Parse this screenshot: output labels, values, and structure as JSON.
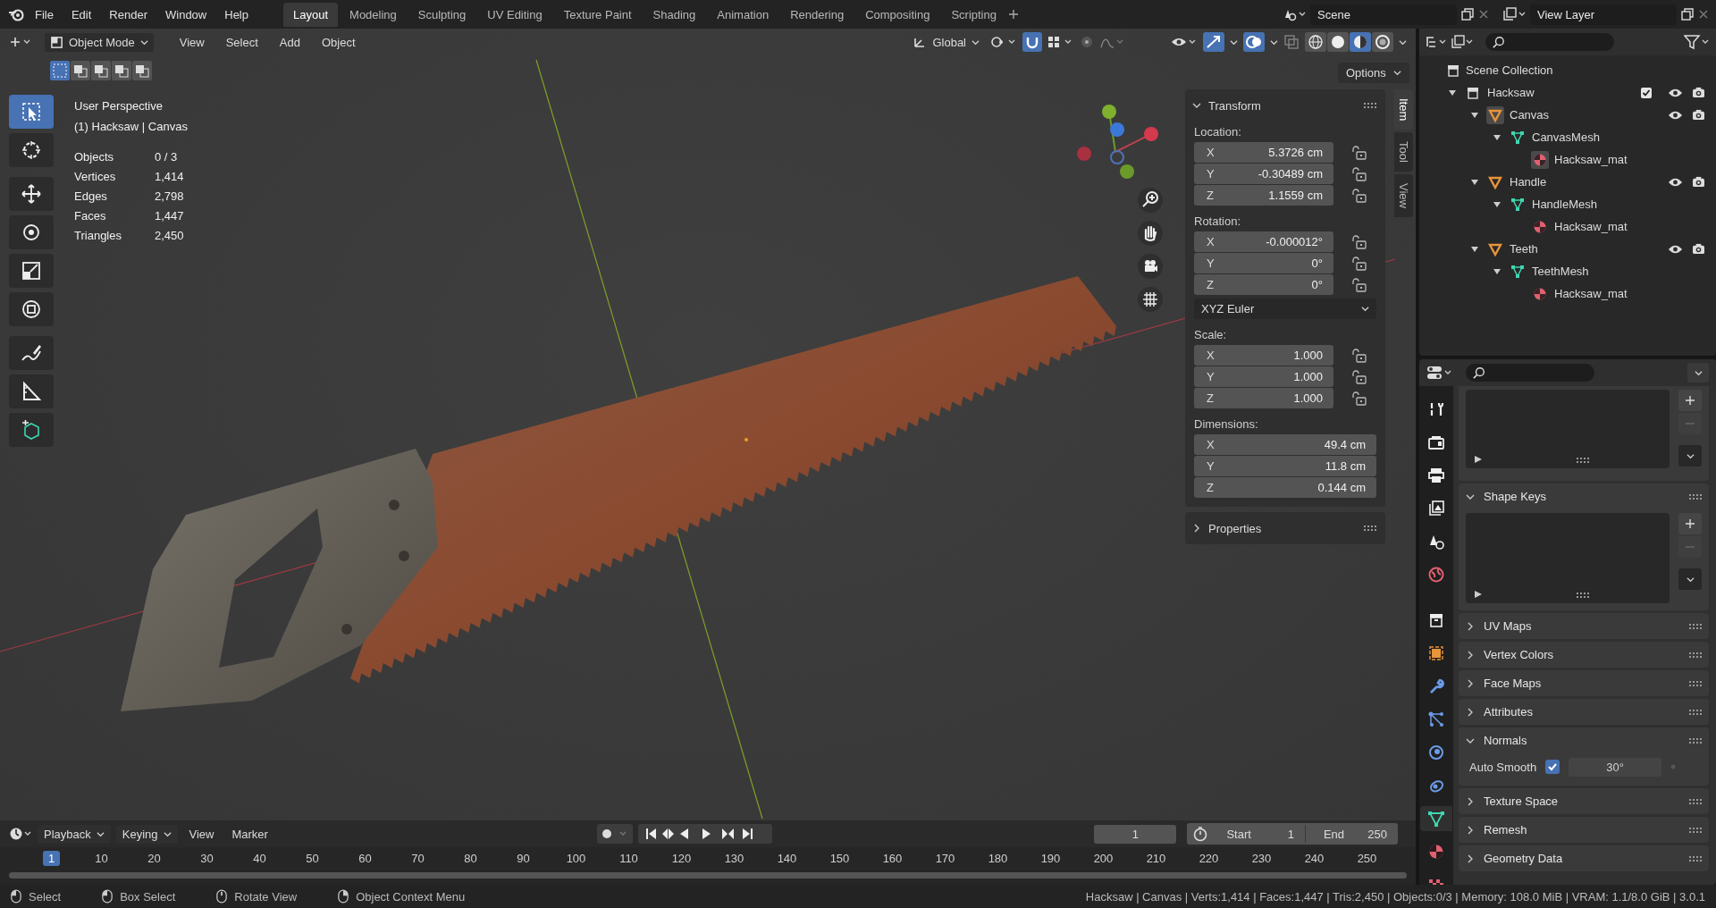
{
  "top_menu": [
    "File",
    "Edit",
    "Render",
    "Window",
    "Help"
  ],
  "workspaces": [
    {
      "label": "Layout",
      "selected": true
    },
    {
      "label": "Modeling",
      "selected": false
    },
    {
      "label": "Sculpting",
      "selected": false
    },
    {
      "label": "UV Editing",
      "selected": false
    },
    {
      "label": "Texture Paint",
      "selected": false
    },
    {
      "label": "Shading",
      "selected": false
    },
    {
      "label": "Animation",
      "selected": false
    },
    {
      "label": "Rendering",
      "selected": false
    },
    {
      "label": "Compositing",
      "selected": false
    },
    {
      "label": "Scripting",
      "selected": false
    }
  ],
  "scene": "Scene",
  "view_layer": "View Layer",
  "viewport": {
    "mode": "Object Mode",
    "menus": [
      "View",
      "Select",
      "Add",
      "Object"
    ],
    "orientation": "Global",
    "options": "Options",
    "overlay_title": "User Perspective",
    "overlay_subtitle": "(1) Hacksaw | Canvas",
    "stats": [
      {
        "label": "Objects",
        "value": "0 / 3"
      },
      {
        "label": "Vertices",
        "value": "1,414"
      },
      {
        "label": "Edges",
        "value": "2,798"
      },
      {
        "label": "Faces",
        "value": "1,447"
      },
      {
        "label": "Triangles",
        "value": "2,450"
      }
    ],
    "tools": [
      {
        "kind": "select-box",
        "selected": true
      },
      {
        "kind": "cursor",
        "selected": false
      },
      {
        "kind": "move",
        "selected": false
      },
      {
        "kind": "rotate",
        "selected": false
      },
      {
        "kind": "scale",
        "selected": false
      },
      {
        "kind": "transform",
        "selected": false
      },
      {
        "kind": "annotate",
        "selected": false
      },
      {
        "kind": "measure",
        "selected": false
      },
      {
        "kind": "add-cube",
        "selected": false
      }
    ],
    "shading": [
      {
        "kind": "wireframe",
        "selected": false
      },
      {
        "kind": "solid",
        "selected": false
      },
      {
        "kind": "material",
        "selected": true
      },
      {
        "kind": "rendered",
        "selected": false
      }
    ]
  },
  "sidebar": {
    "tabs": [
      {
        "label": "Item",
        "selected": true
      },
      {
        "label": "Tool",
        "selected": false
      },
      {
        "label": "View",
        "selected": false
      }
    ],
    "transform": {
      "title": "Transform",
      "groups": [
        {
          "label": "Location:",
          "kind": "lockable",
          "fields": [
            {
              "axis": "X",
              "value": "5.3726 cm"
            },
            {
              "axis": "Y",
              "value": "-0.30489 cm"
            },
            {
              "axis": "Z",
              "value": "1.1559 cm"
            }
          ]
        },
        {
          "label": "Rotation:",
          "kind": "lockable",
          "fields": [
            {
              "axis": "X",
              "value": "-0.000012°"
            },
            {
              "axis": "Y",
              "value": "0°"
            },
            {
              "axis": "Z",
              "value": "0°"
            }
          ],
          "mode": "XYZ Euler"
        },
        {
          "label": "Scale:",
          "kind": "lockable",
          "fields": [
            {
              "axis": "X",
              "value": "1.000"
            },
            {
              "axis": "Y",
              "value": "1.000"
            },
            {
              "axis": "Z",
              "value": "1.000"
            }
          ]
        },
        {
          "label": "Dimensions:",
          "kind": "plain",
          "fields": [
            {
              "axis": "X",
              "value": "49.4 cm"
            },
            {
              "axis": "Y",
              "value": "11.8 cm"
            },
            {
              "axis": "Z",
              "value": "0.144 cm"
            }
          ]
        }
      ]
    },
    "panels": [
      {
        "title": "Properties",
        "expanded": false
      }
    ]
  },
  "outliner": {
    "root": "Scene Collection",
    "tree": [
      {
        "name": "Hacksaw",
        "kind": "collection",
        "active": false,
        "checked": true,
        "visible": true,
        "renderable": true,
        "children": [
          {
            "name": "Canvas",
            "kind": "object",
            "active": true,
            "visible": true,
            "renderable": true,
            "children": [
              {
                "name": "CanvasMesh",
                "kind": "mesh",
                "active": false,
                "children": [
                  {
                    "name": "Hacksaw_mat",
                    "kind": "material",
                    "active": true
                  }
                ]
              }
            ]
          },
          {
            "name": "Handle",
            "kind": "object",
            "active": false,
            "visible": true,
            "renderable": true,
            "children": [
              {
                "name": "HandleMesh",
                "kind": "mesh",
                "active": false,
                "children": [
                  {
                    "name": "Hacksaw_mat",
                    "kind": "material",
                    "active": false
                  }
                ]
              }
            ]
          },
          {
            "name": "Teeth",
            "kind": "object",
            "active": false,
            "visible": true,
            "renderable": true,
            "children": [
              {
                "name": "TeethMesh",
                "kind": "mesh",
                "active": false,
                "children": [
                  {
                    "name": "Hacksaw_mat",
                    "kind": "material",
                    "active": false
                  }
                ]
              }
            ]
          }
        ]
      }
    ]
  },
  "properties": {
    "tabs": [
      {
        "kind": "tool",
        "selected": false
      },
      {
        "kind": "render",
        "selected": false
      },
      {
        "kind": "output",
        "selected": false
      },
      {
        "kind": "view-layer",
        "selected": false
      },
      {
        "kind": "scene",
        "selected": false
      },
      {
        "kind": "world",
        "selected": false
      },
      {
        "kind": "collection",
        "selected": false
      },
      {
        "kind": "object",
        "selected": false
      },
      {
        "kind": "modifiers",
        "selected": false
      },
      {
        "kind": "particles",
        "selected": false
      },
      {
        "kind": "physics",
        "selected": false
      },
      {
        "kind": "constraints",
        "selected": false
      },
      {
        "kind": "data",
        "selected": true
      },
      {
        "kind": "material",
        "selected": false
      },
      {
        "kind": "texture",
        "selected": false
      }
    ],
    "sections": [
      {
        "kind": "list"
      },
      {
        "kind": "list-panel",
        "title": "Shape Keys",
        "expanded": true
      },
      {
        "kind": "panel",
        "title": "UV Maps",
        "expanded": false
      },
      {
        "kind": "panel",
        "title": "Vertex Colors",
        "expanded": false
      },
      {
        "kind": "panel",
        "title": "Face Maps",
        "expanded": false
      },
      {
        "kind": "panel",
        "title": "Attributes",
        "expanded": false
      },
      {
        "kind": "option-panel",
        "title": "Normals",
        "expanded": true,
        "option": {
          "label": "Auto Smooth",
          "checked": true,
          "value": "30°"
        }
      },
      {
        "kind": "panel",
        "title": "Texture Space",
        "expanded": false
      },
      {
        "kind": "panel",
        "title": "Remesh",
        "expanded": false
      },
      {
        "kind": "panel",
        "title": "Geometry Data",
        "expanded": false
      }
    ]
  },
  "timeline": {
    "menus": [
      "Playback",
      "Keying",
      "View",
      "Marker"
    ],
    "current_frame": "1",
    "start_label": "Start",
    "start": "1",
    "end_label": "End",
    "end": "250",
    "ruler": [
      {
        "label": "1",
        "selected": true
      },
      {
        "label": "10",
        "selected": false
      },
      {
        "label": "20",
        "selected": false
      },
      {
        "label": "30",
        "selected": false
      },
      {
        "label": "40",
        "selected": false
      },
      {
        "label": "50",
        "selected": false
      },
      {
        "label": "60",
        "selected": false
      },
      {
        "label": "70",
        "selected": false
      },
      {
        "label": "80",
        "selected": false
      },
      {
        "label": "90",
        "selected": false
      },
      {
        "label": "100",
        "selected": false
      },
      {
        "label": "110",
        "selected": false
      },
      {
        "label": "120",
        "selected": false
      },
      {
        "label": "130",
        "selected": false
      },
      {
        "label": "140",
        "selected": false
      },
      {
        "label": "150",
        "selected": false
      },
      {
        "label": "160",
        "selected": false
      },
      {
        "label": "170",
        "selected": false
      },
      {
        "label": "180",
        "selected": false
      },
      {
        "label": "190",
        "selected": false
      },
      {
        "label": "200",
        "selected": false
      },
      {
        "label": "210",
        "selected": false
      },
      {
        "label": "220",
        "selected": false
      },
      {
        "label": "230",
        "selected": false
      },
      {
        "label": "240",
        "selected": false
      },
      {
        "label": "250",
        "selected": false
      }
    ]
  },
  "status_bar": {
    "hints": [
      {
        "kind": "left",
        "label": "Select"
      },
      {
        "kind": "drag",
        "label": "Box Select"
      },
      {
        "kind": "middle",
        "label": "Rotate View"
      },
      {
        "kind": "right",
        "label": "Object Context Menu"
      }
    ],
    "info": "Hacksaw | Canvas | Verts:1,414 | Faces:1,447 | Tris:2,450 | Objects:0/3 | Memory: 108.0 MiB | VRAM: 1.1/8.0 GiB | 3.0.1"
  }
}
